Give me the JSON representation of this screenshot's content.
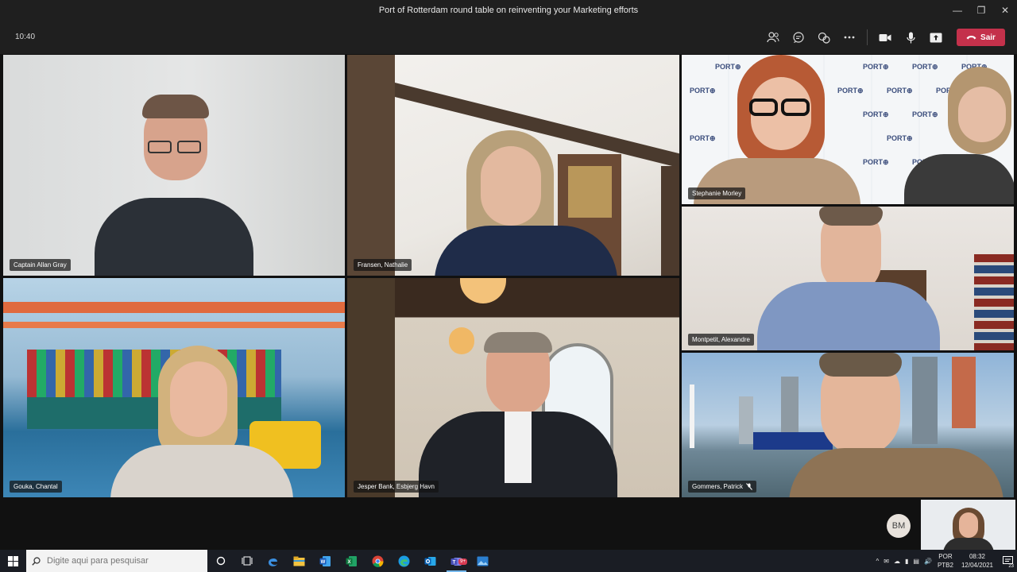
{
  "window": {
    "title": "Port of Rotterdam round table on reinventing your Marketing efforts"
  },
  "toolbar": {
    "elapsed": "10:40",
    "leave_label": "Sair",
    "icons": [
      "participants-icon",
      "chat-icon",
      "breakout-rooms-icon",
      "more-actions-icon",
      "camera-icon",
      "microphone-icon",
      "share-screen-icon",
      "phone-hangup-icon"
    ]
  },
  "participants": [
    {
      "name": "Captain Allan Gray"
    },
    {
      "name": "Fransen, Nathalie"
    },
    {
      "name": "Stephanie Morley"
    },
    {
      "name": "Gouka, Chantal"
    },
    {
      "name": "Jesper Bank, Esbjerg Havn"
    },
    {
      "name": "Montpetit, Alexandre"
    },
    {
      "name": "Gommers, Patrick",
      "muted": true
    }
  ],
  "self": {
    "initials": "BM"
  },
  "taskbar": {
    "search_placeholder": "Digite aqui para pesquisar",
    "apps": [
      "cortana-icon",
      "task-view-icon",
      "edge-legacy-icon",
      "file-explorer-icon",
      "word-icon",
      "excel-icon",
      "chrome-icon",
      "edge-icon",
      "outlook-icon",
      "teams-icon",
      "photos-icon"
    ],
    "teams_badge": "9+",
    "language": "POR",
    "keyboard": "PTB2",
    "time": "08:32",
    "date": "12/04/2021",
    "notifications": "23"
  },
  "colors": {
    "leave": "#c4314b",
    "background": "#1f1f1f"
  }
}
